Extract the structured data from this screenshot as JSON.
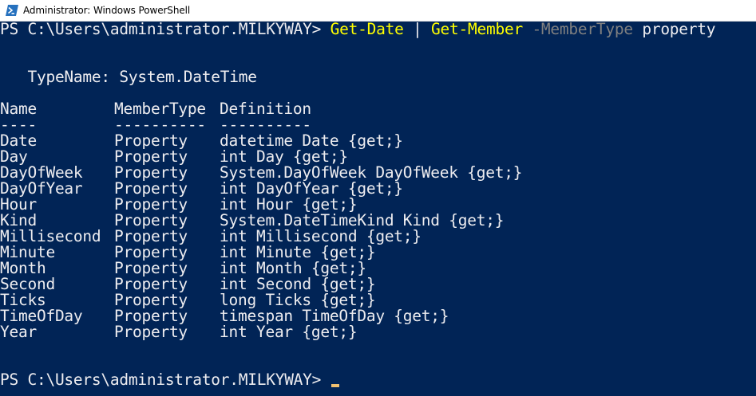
{
  "window": {
    "title": "Administrator: Windows PowerShell",
    "icon": "powershell-icon",
    "background_color": "#012456",
    "text_color": "#eeedf0",
    "command_color": "#ffff00",
    "parameter_color": "#808080"
  },
  "console": {
    "prompt": "PS C:\\Users\\administrator.MILKYWAY> ",
    "command1": {
      "cmdlet1": "Get-Date",
      "pipe": " | ",
      "cmdlet2": "Get-Member",
      "param": " -MemberType",
      "arg": " property"
    },
    "typename_line": "   TypeName: System.DateTime",
    "header": {
      "name": "Name",
      "membertype": "MemberType",
      "definition": "Definition"
    },
    "separator": {
      "name": "----",
      "membertype": "----------",
      "definition": "----------"
    },
    "rows": [
      {
        "name": "Date",
        "membertype": "Property",
        "definition": "datetime Date {get;}"
      },
      {
        "name": "Day",
        "membertype": "Property",
        "definition": "int Day {get;}"
      },
      {
        "name": "DayOfWeek",
        "membertype": "Property",
        "definition": "System.DayOfWeek DayOfWeek {get;}"
      },
      {
        "name": "DayOfYear",
        "membertype": "Property",
        "definition": "int DayOfYear {get;}"
      },
      {
        "name": "Hour",
        "membertype": "Property",
        "definition": "int Hour {get;}"
      },
      {
        "name": "Kind",
        "membertype": "Property",
        "definition": "System.DateTimeKind Kind {get;}"
      },
      {
        "name": "Millisecond",
        "membertype": "Property",
        "definition": "int Millisecond {get;}"
      },
      {
        "name": "Minute",
        "membertype": "Property",
        "definition": "int Minute {get;}"
      },
      {
        "name": "Month",
        "membertype": "Property",
        "definition": "int Month {get;}"
      },
      {
        "name": "Second",
        "membertype": "Property",
        "definition": "int Second {get;}"
      },
      {
        "name": "Ticks",
        "membertype": "Property",
        "definition": "long Ticks {get;}"
      },
      {
        "name": "TimeOfDay",
        "membertype": "Property",
        "definition": "timespan TimeOfDay {get;}"
      },
      {
        "name": "Year",
        "membertype": "Property",
        "definition": "int Year {get;}"
      }
    ],
    "final_prompt": "PS C:\\Users\\administrator.MILKYWAY> "
  }
}
